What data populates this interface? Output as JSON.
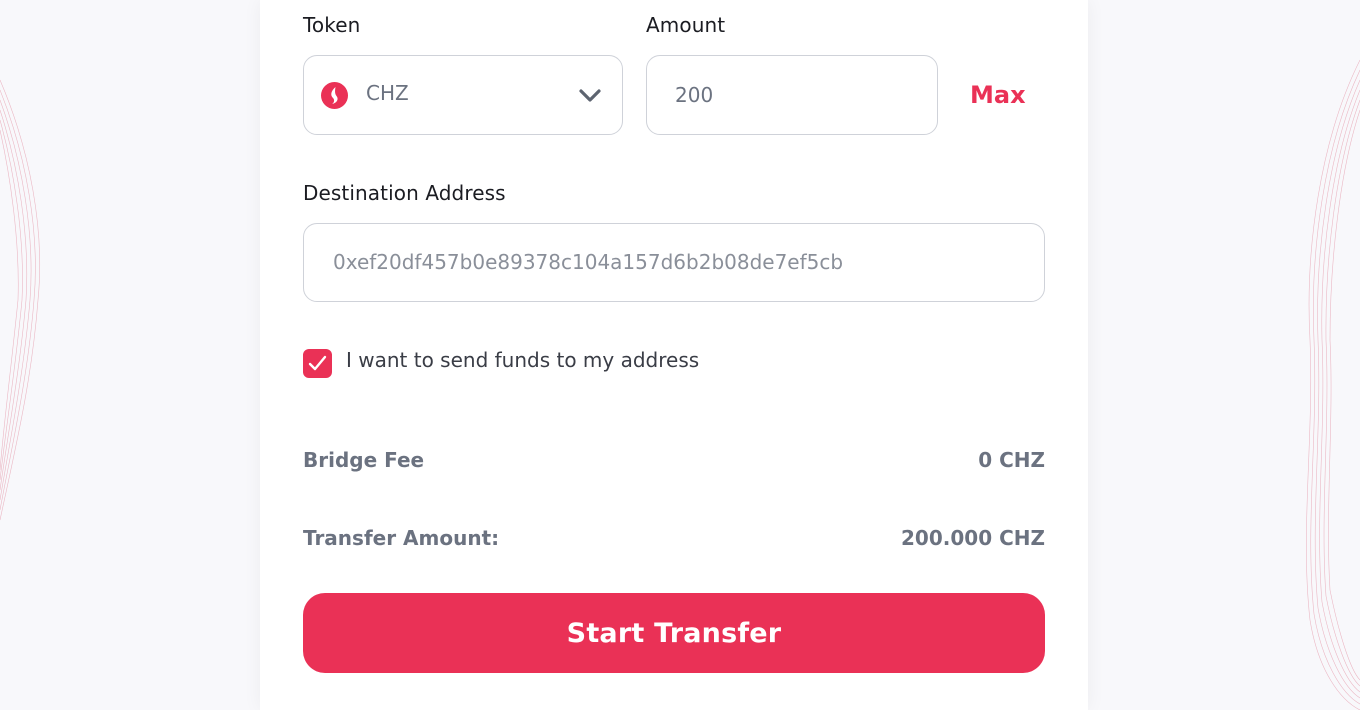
{
  "form": {
    "token_label": "Token",
    "amount_label": "Amount",
    "destination_label": "Destination Address",
    "max_label": "Max"
  },
  "token": {
    "selected": "CHZ",
    "icon": "chz-token-icon"
  },
  "amount": {
    "value": "200"
  },
  "destination": {
    "value": "0xef20df457b0e89378c104a157d6b2b08de7ef5cb"
  },
  "send_to_self": {
    "checked": true,
    "label": "I want to send funds to my address"
  },
  "summary": {
    "bridge_fee_label": "Bridge Fee",
    "bridge_fee_value": "0 CHZ",
    "transfer_amount_label": "Transfer Amount:",
    "transfer_amount_value": "200.000 CHZ"
  },
  "actions": {
    "start_transfer_label": "Start Transfer"
  },
  "colors": {
    "accent": "#ea3156",
    "muted_text": "#6b7280",
    "border": "#cfd2d9",
    "page_background": "#f8f8fb"
  }
}
